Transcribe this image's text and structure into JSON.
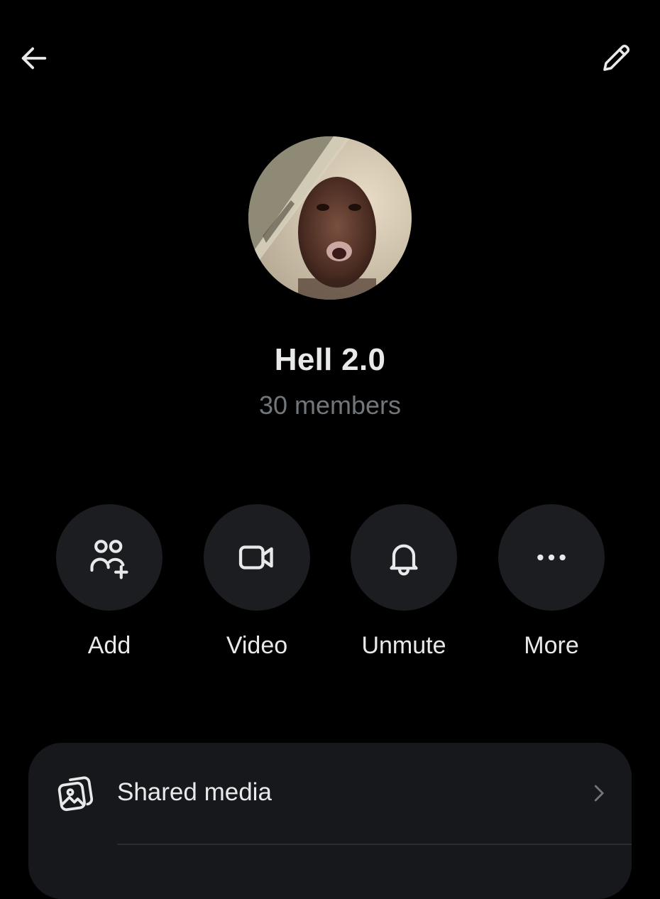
{
  "header": {
    "back_icon": "arrow-left-icon",
    "edit_icon": "pencil-icon"
  },
  "group": {
    "name": "Hell 2.0",
    "member_count": "30 members"
  },
  "actions": [
    {
      "label": "Add",
      "icon": "add-people-icon"
    },
    {
      "label": "Video",
      "icon": "video-camera-icon"
    },
    {
      "label": "Unmute",
      "icon": "bell-icon"
    },
    {
      "label": "More",
      "icon": "more-dots-icon"
    }
  ],
  "settings": {
    "rows": [
      {
        "label": "Shared media",
        "icon": "media-icon"
      }
    ]
  },
  "colors": {
    "background": "#000000",
    "primary_text": "#e7e9ea",
    "secondary_text": "#71767b",
    "button_fill": "#1c1d20",
    "card_fill": "#16181c"
  }
}
